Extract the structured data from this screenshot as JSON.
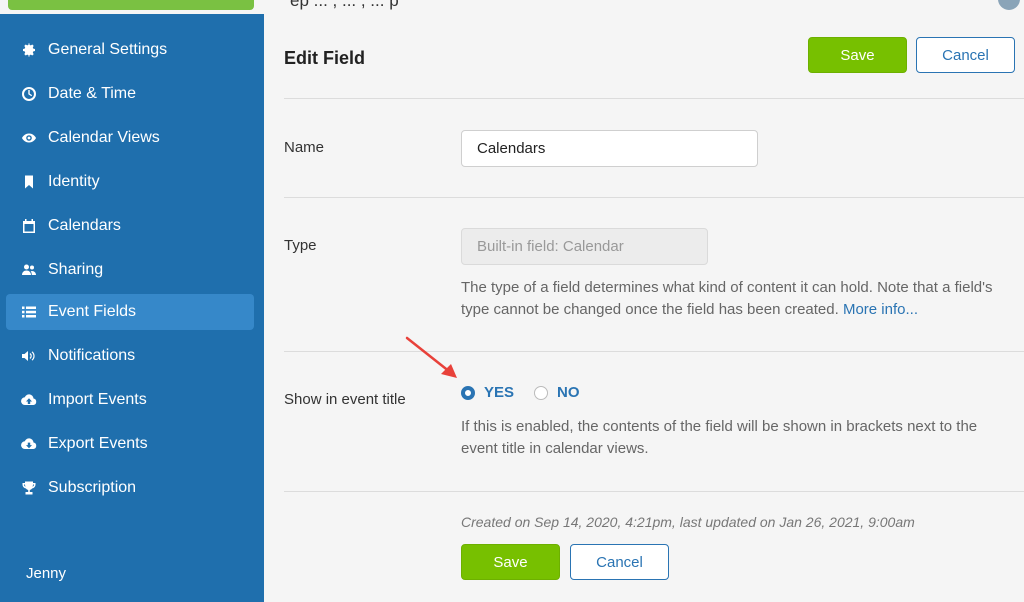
{
  "topbar": {
    "text": "ep ... , ... , ... p"
  },
  "sidebar": {
    "items": [
      {
        "label": "General Settings",
        "icon": "gear-icon"
      },
      {
        "label": "Date & Time",
        "icon": "clock-icon"
      },
      {
        "label": "Calendar Views",
        "icon": "eye-icon"
      },
      {
        "label": "Identity",
        "icon": "bookmark-icon"
      },
      {
        "label": "Calendars",
        "icon": "calendar-icon"
      },
      {
        "label": "Sharing",
        "icon": "users-icon"
      },
      {
        "label": "Event Fields",
        "icon": "list-icon"
      },
      {
        "label": "Notifications",
        "icon": "speaker-icon"
      },
      {
        "label": "Import Events",
        "icon": "cloud-upload-icon"
      },
      {
        "label": "Export Events",
        "icon": "cloud-download-icon"
      },
      {
        "label": "Subscription",
        "icon": "trophy-icon"
      }
    ],
    "active_item": "Event Fields",
    "user": "Jenny"
  },
  "header": {
    "title": "Edit Field",
    "save_label": "Save",
    "cancel_label": "Cancel"
  },
  "form": {
    "name_label": "Name",
    "name_value": "Calendars",
    "type_label": "Type",
    "type_value": "Built-in field: Calendar",
    "type_help": "The type of a field determines what kind of content it can hold. Note that a field's type cannot be changed once the field has been created.",
    "type_help_link": "More info...",
    "show_title_label": "Show in event title",
    "option_yes": "YES",
    "option_no": "NO",
    "selected_option": "YES",
    "show_title_help": "If this is enabled, the contents of the field will be shown in brackets next to the event title in calendar views."
  },
  "footer": {
    "meta": "Created on Sep 14, 2020, 4:21pm, last updated on Jan 26, 2021, 9:00am",
    "save_label": "Save",
    "cancel_label": "Cancel"
  },
  "colors": {
    "sidebar_bg": "#1f6fad",
    "sidebar_active": "#3688c9",
    "accent_green": "#77c000",
    "accent_blue": "#2a74b3",
    "annotation_arrow": "#e8413a"
  }
}
